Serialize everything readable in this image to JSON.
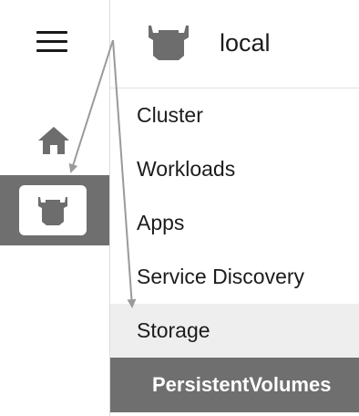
{
  "header": {
    "cluster_name": "local",
    "logo_icon": "rancher-bull-icon"
  },
  "rail": {
    "menu_icon": "hamburger-menu-icon",
    "home_icon": "home-icon",
    "cluster_icon": "rancher-bull-icon"
  },
  "nav": {
    "items": [
      {
        "label": "Cluster"
      },
      {
        "label": "Workloads"
      },
      {
        "label": "Apps"
      },
      {
        "label": "Service Discovery"
      },
      {
        "label": "Storage"
      },
      {
        "label": "PersistentVolumes"
      }
    ]
  },
  "colors": {
    "active_bg": "#6f6f6f",
    "selected_bg": "#eeeeee",
    "icon_gray": "#6d6d6d",
    "arrow_gray": "#9a9a9a"
  }
}
